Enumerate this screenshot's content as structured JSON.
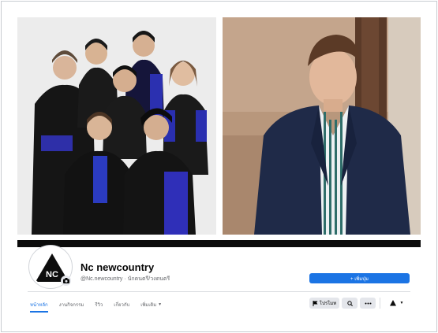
{
  "page": {
    "name": "Nc newcountry",
    "handle_line": "@Nc.newcountry · นักดนตรี/วงดนตรี"
  },
  "avatar": {
    "logo_text": "NC"
  },
  "actions": {
    "primary_label": "+ เพิ่มปุ่ม",
    "promote_label": "โปรโมท"
  },
  "tabs": [
    {
      "label": "หน้าหลัก",
      "active": true
    },
    {
      "label": "งานกิจกรรม",
      "active": false
    },
    {
      "label": "รีวิว",
      "active": false
    },
    {
      "label": "เกี่ยวกับ",
      "active": false
    },
    {
      "label": "เพิ่มเติม",
      "active": false
    }
  ],
  "icons": {
    "camera": "camera-icon",
    "flag": "flag-icon",
    "search": "search-icon",
    "more": "more-dots-icon",
    "caret": "caret-down-icon"
  },
  "colors": {
    "accent": "#1b74e4",
    "button_gray": "#e4e6eb",
    "cover_bar": "#0b0b0b"
  }
}
